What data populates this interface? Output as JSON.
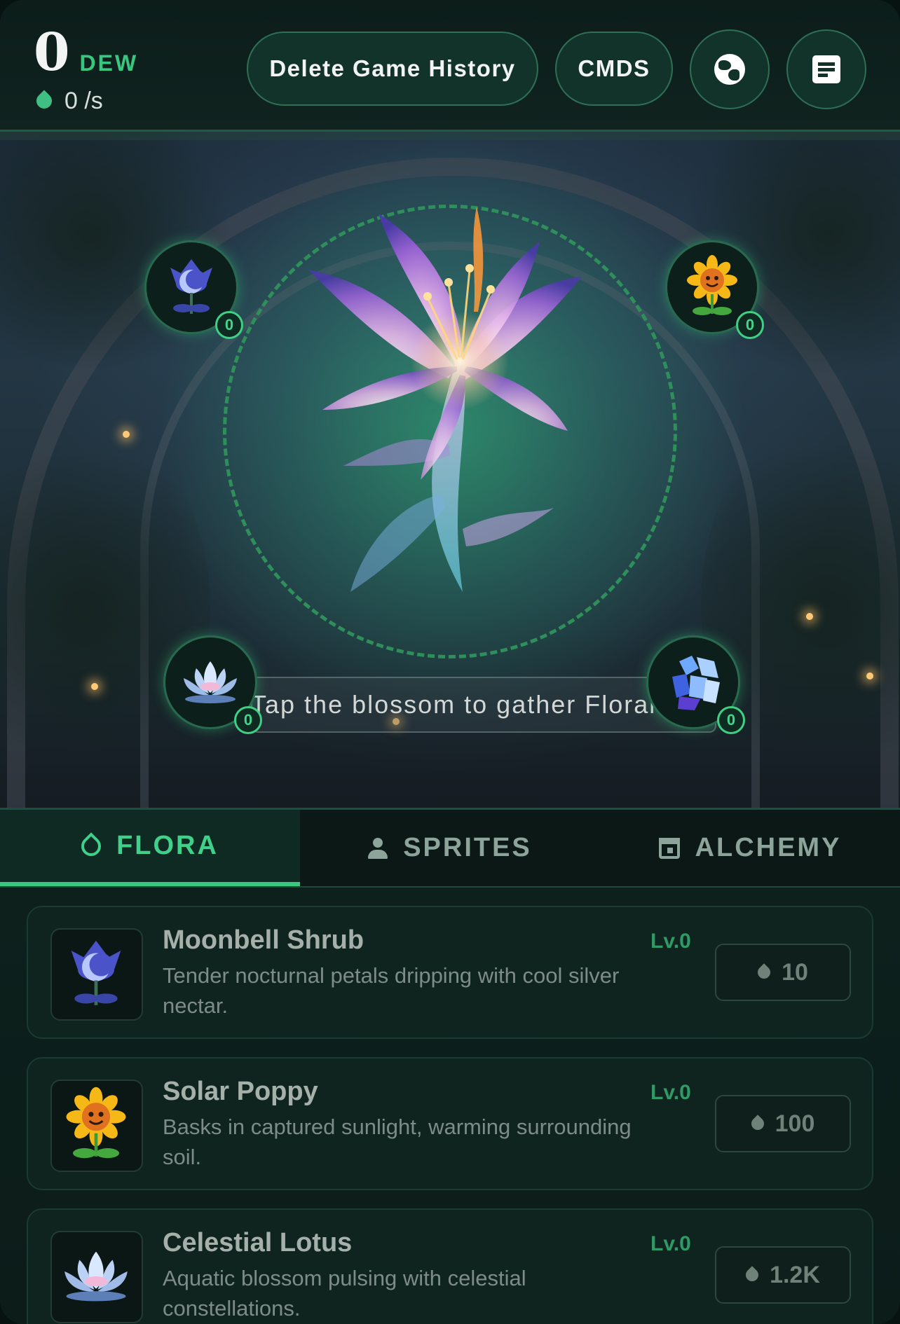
{
  "header": {
    "dew_amount": "0",
    "dew_unit": "DEW",
    "rate": "0 /s",
    "delete_label": "Delete Game History",
    "cmds_label": "CMDS"
  },
  "colors": {
    "accent": "#38c97f",
    "background": "#0a1a17",
    "panel": "#10241f"
  },
  "scene": {
    "hint": "Tap the blossom to gather Floral L",
    "sprites": [
      {
        "name": "moonbell",
        "icon": "moonbell-icon",
        "count": "0"
      },
      {
        "name": "solar",
        "icon": "sunflower-icon",
        "count": "0"
      },
      {
        "name": "lotus",
        "icon": "lotus-icon",
        "count": "0"
      },
      {
        "name": "crystal",
        "icon": "crystal-icon",
        "count": "0"
      }
    ]
  },
  "tabs": [
    {
      "label": "FLORA",
      "icon": "drop-icon",
      "active": true
    },
    {
      "label": "SPRITES",
      "icon": "person-icon",
      "active": false
    },
    {
      "label": "ALCHEMY",
      "icon": "calendar-icon",
      "active": false
    }
  ],
  "flora": [
    {
      "title": "Moonbell Shrub",
      "level": "Lv.0",
      "description": "Tender nocturnal petals dripping with cool silver nectar.",
      "cost": "10"
    },
    {
      "title": "Solar Poppy",
      "level": "Lv.0",
      "description": "Basks in captured sunlight, warming surrounding soil.",
      "cost": "100"
    },
    {
      "title": "Celestial Lotus",
      "level": "Lv.0",
      "description": "Aquatic blossom pulsing with celestial constellations.",
      "cost": "1.2K"
    }
  ]
}
